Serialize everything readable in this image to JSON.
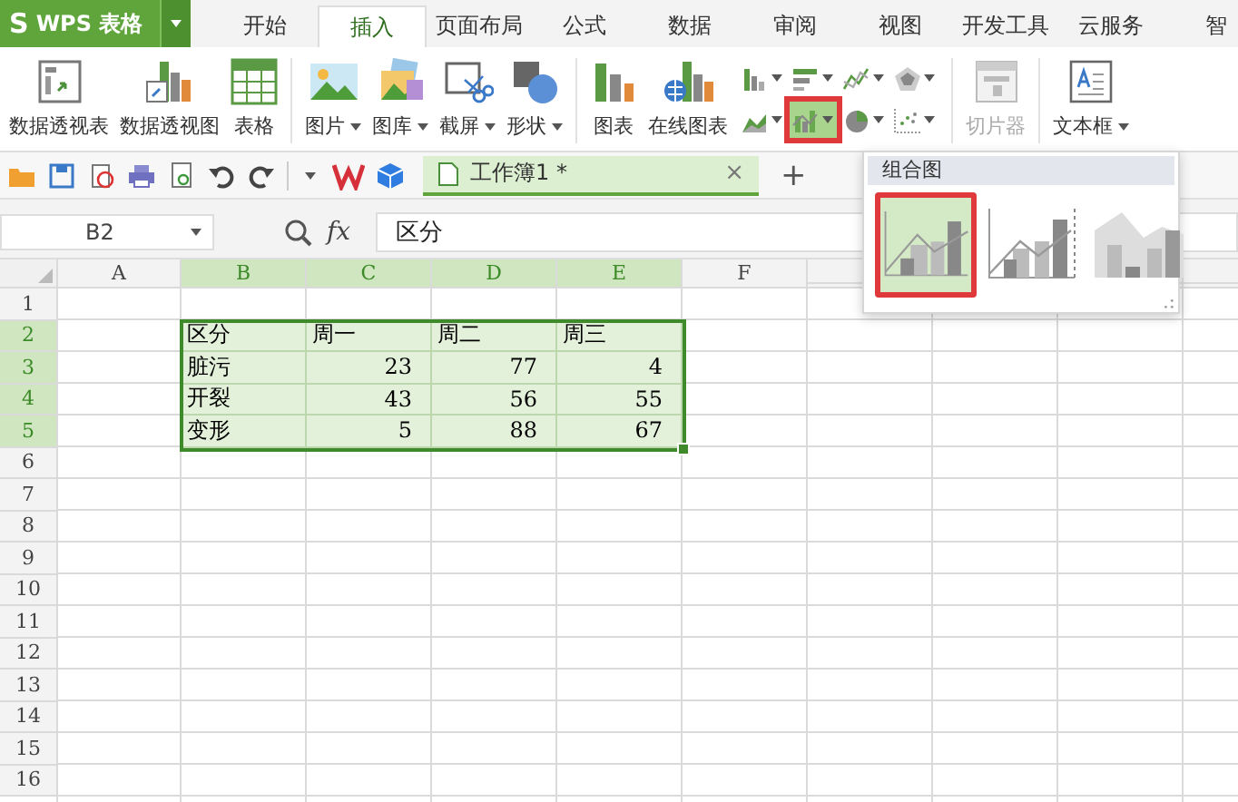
{
  "app": {
    "logo": "S",
    "name": "WPS 表格"
  },
  "menu_tabs": [
    {
      "label": "开始",
      "selected": false
    },
    {
      "label": "插入",
      "selected": true
    },
    {
      "label": "页面布局",
      "selected": false
    },
    {
      "label": "公式",
      "selected": false
    },
    {
      "label": "数据",
      "selected": false
    },
    {
      "label": "审阅",
      "selected": false
    },
    {
      "label": "视图",
      "selected": false
    },
    {
      "label": "开发工具",
      "selected": false
    },
    {
      "label": "云服务",
      "selected": false
    },
    {
      "label": "智",
      "selected": false
    }
  ],
  "ribbon": {
    "groups": [
      {
        "items": [
          {
            "label": "数据透视表",
            "dropdown": false,
            "disabled": false
          },
          {
            "label": "数据透视图",
            "dropdown": false,
            "disabled": false
          },
          {
            "label": "表格",
            "dropdown": false,
            "disabled": false
          }
        ]
      },
      {
        "items": [
          {
            "label": "图片",
            "dropdown": true,
            "disabled": false
          },
          {
            "label": "图库",
            "dropdown": true,
            "disabled": false
          },
          {
            "label": "截屏",
            "dropdown": true,
            "disabled": false
          },
          {
            "label": "形状",
            "dropdown": true,
            "disabled": false
          }
        ]
      },
      {
        "items": [
          {
            "label": "图表",
            "dropdown": false,
            "disabled": false
          },
          {
            "label": "在线图表",
            "dropdown": false,
            "disabled": false
          }
        ],
        "chart_buttons": [
          {
            "expanded": false
          },
          {
            "expanded": false
          },
          {
            "expanded": false
          },
          {
            "expanded": false
          },
          {
            "expanded": false
          },
          {
            "expanded": true
          },
          {
            "expanded": false
          },
          {
            "expanded": false
          }
        ]
      },
      {
        "items": [
          {
            "label": "切片器",
            "dropdown": false,
            "disabled": true
          }
        ]
      },
      {
        "items": [
          {
            "label": "文本框",
            "dropdown": true,
            "disabled": false
          }
        ]
      }
    ]
  },
  "doc_tab": {
    "label": "工作簿1 *",
    "close": "×",
    "new_tab": "+"
  },
  "formula_bar": {
    "name_box": "B2",
    "function_label": "fx",
    "value": "区分"
  },
  "sheet": {
    "columns": [
      {
        "label": "A",
        "selected": false
      },
      {
        "label": "B",
        "selected": true
      },
      {
        "label": "C",
        "selected": true
      },
      {
        "label": "D",
        "selected": true
      },
      {
        "label": "E",
        "selected": true
      },
      {
        "label": "F",
        "selected": false
      }
    ],
    "rows": [
      {
        "number": "1",
        "selected": false,
        "kind": "blank",
        "cells": []
      },
      {
        "number": "2",
        "selected": true,
        "kind": "labels",
        "cells": [
          "",
          "区分",
          "周一",
          "周二",
          "周三"
        ]
      },
      {
        "number": "3",
        "selected": true,
        "kind": "values",
        "cells": [
          "",
          "脏污",
          "23",
          "77",
          "4"
        ]
      },
      {
        "number": "4",
        "selected": true,
        "kind": "values",
        "cells": [
          "",
          "开裂",
          "43",
          "56",
          "55"
        ]
      },
      {
        "number": "5",
        "selected": true,
        "kind": "values",
        "cells": [
          "",
          "变形",
          "5",
          "88",
          "67"
        ]
      },
      {
        "number": "6",
        "selected": false,
        "kind": "blank",
        "cells": []
      },
      {
        "number": "7",
        "selected": false,
        "kind": "blank",
        "cells": []
      },
      {
        "number": "8",
        "selected": false,
        "kind": "blank",
        "cells": []
      },
      {
        "number": "9",
        "selected": false,
        "kind": "blank",
        "cells": []
      },
      {
        "number": "10",
        "selected": false,
        "kind": "blank",
        "cells": []
      },
      {
        "number": "11",
        "selected": false,
        "kind": "blank",
        "cells": []
      },
      {
        "number": "12",
        "selected": false,
        "kind": "blank",
        "cells": []
      },
      {
        "number": "13",
        "selected": false,
        "kind": "blank",
        "cells": []
      },
      {
        "number": "14",
        "selected": false,
        "kind": "blank",
        "cells": []
      },
      {
        "number": "15",
        "selected": false,
        "kind": "blank",
        "cells": []
      },
      {
        "number": "16",
        "selected": false,
        "kind": "blank",
        "cells": []
      }
    ]
  },
  "chart_menu": {
    "title": "组合图",
    "options": [
      {
        "selected": true
      },
      {
        "selected": false
      },
      {
        "selected": false
      }
    ]
  }
}
